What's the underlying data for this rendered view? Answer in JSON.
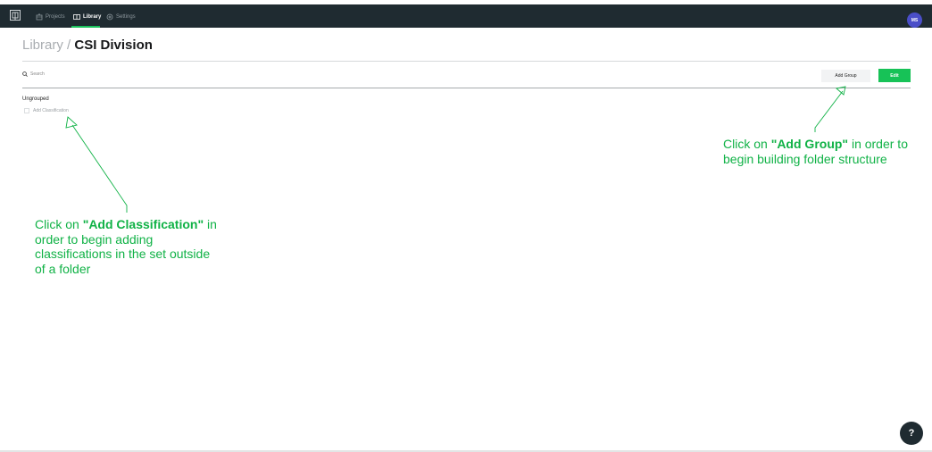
{
  "nav": {
    "items": [
      {
        "label": "Projects",
        "icon": "projects-icon"
      },
      {
        "label": "Library",
        "icon": "library-icon",
        "active": true
      },
      {
        "label": "Settings",
        "icon": "gear-icon"
      }
    ],
    "avatar_initials": "MS",
    "accent": "#19c25b"
  },
  "header": {
    "breadcrumb_root": "Library",
    "breadcrumb_sep": "/",
    "title": "CSI Division"
  },
  "toolbar": {
    "search_placeholder": "Search",
    "add_group_label": "Add Group",
    "edit_label": "Edit"
  },
  "content": {
    "section_label": "Ungrouped",
    "add_classification_label": "Add Classification"
  },
  "callouts": {
    "right": {
      "before": "Click on ",
      "emph": "\"Add Group\"",
      "after": " in order to begin building folder structure"
    },
    "left": {
      "before": "Click on ",
      "emph": "\"Add Classification\"",
      "after": " in order to begin adding classifications in the set outside of a folder"
    },
    "color": "#10b246"
  },
  "help": {
    "label": "?"
  }
}
